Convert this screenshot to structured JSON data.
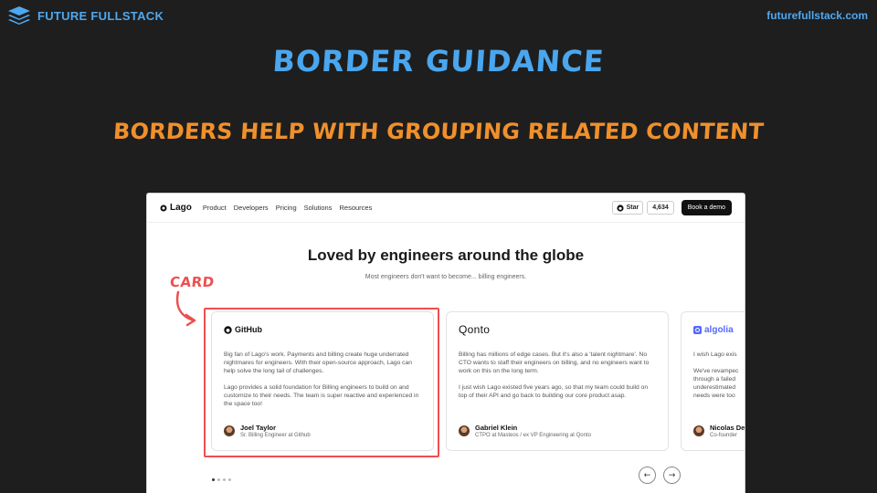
{
  "brand": {
    "name": "FUTURE FULLSTACK",
    "url": "futurefullstack.com"
  },
  "slide": {
    "title": "BORDER GUIDANCE",
    "subtitle": "BORDERS HELP WITH GROUPING RELATED CONTENT",
    "annotation": "CARD"
  },
  "screenshot": {
    "nav": {
      "logo": "Lago",
      "links": [
        "Product",
        "Developers",
        "Pricing",
        "Solutions",
        "Resources"
      ],
      "star_label": "Star",
      "star_count": "4,634",
      "demo_label": "Book a demo"
    },
    "section": {
      "title": "Loved by engineers around the globe",
      "subtitle": "Most engineers don't want to become... billing engineers."
    },
    "cards": [
      {
        "company": "GitHub",
        "paragraphs": [
          "Big fan of Lago's work. Payments and billing create huge underrated nightmares for engineers. With their open-source approach, Lago can help solve the long tail of challenges.",
          "Lago provides a solid foundation for Billing engineers to build on and customize to their needs. The team is super reactive and experienced in the space too!"
        ],
        "person": "Joel Taylor",
        "role": "Sr. Billing Engineer at Github"
      },
      {
        "company": "Qonto",
        "paragraphs": [
          "Billing has millions of edge cases. But it's also a 'talent nightmare'. No CTO wants to staff their engineers on billing, and no engineers want to work on this on the long term.",
          "I just wish Lago existed five years ago, so that my team could build on top of their API and go back to building our core product asap."
        ],
        "person": "Gabriel Klein",
        "role": "CTPO at Masteos / ex VP Engineering at Qonto"
      },
      {
        "company": "algolia",
        "paragraphs": [
          "I wish Lago exis",
          "We've revampec through a failed underestimated needs were too"
        ],
        "person": "Nicolas De",
        "role": "Co-founder"
      }
    ],
    "carousel": {
      "prev_icon": "arrow-left-icon",
      "next_icon": "arrow-right-icon",
      "prev": "←",
      "next": "→"
    }
  },
  "colors": {
    "background": "#1e1e1e",
    "title": "#4aa6ee",
    "subtitle": "#f0902c",
    "annotation": "#ee4f4f"
  }
}
